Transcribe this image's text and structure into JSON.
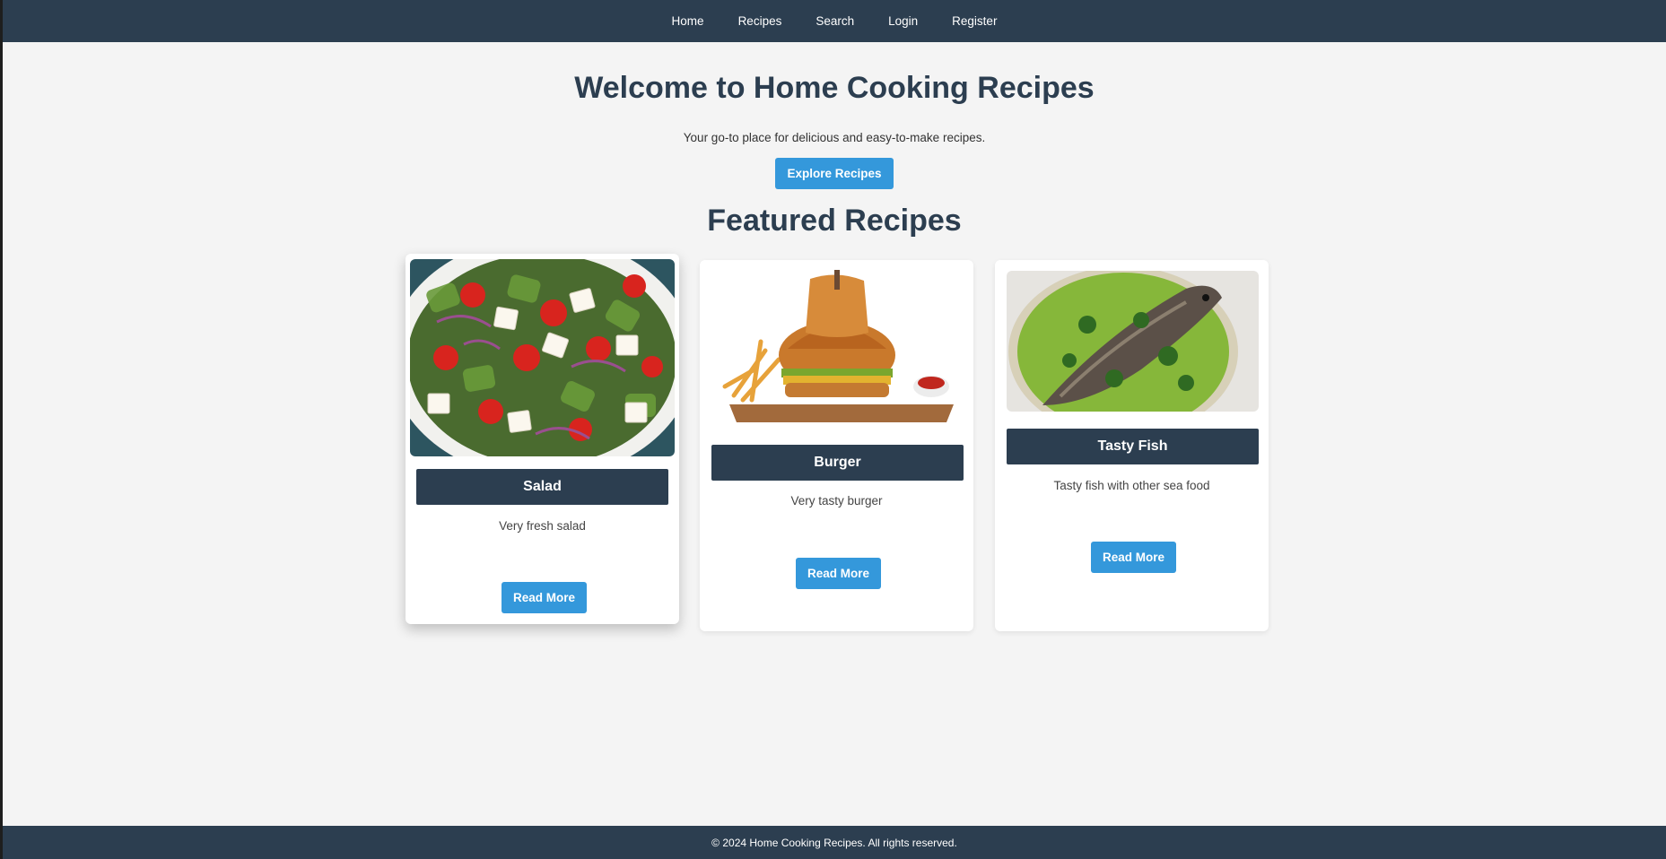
{
  "nav": {
    "items": [
      {
        "label": "Home"
      },
      {
        "label": "Recipes"
      },
      {
        "label": "Search"
      },
      {
        "label": "Login"
      },
      {
        "label": "Register"
      }
    ]
  },
  "hero": {
    "title": "Welcome to Home Cooking Recipes",
    "subtitle": "Your go-to place for delicious and easy-to-make recipes.",
    "button_label": "Explore Recipes"
  },
  "featured": {
    "title": "Featured Recipes",
    "cards": [
      {
        "title": "Salad",
        "description": "Very fresh salad",
        "button_label": "Read More",
        "image": "salad-photo"
      },
      {
        "title": "Burger",
        "description": "Very tasty burger",
        "button_label": "Read More",
        "image": "burger-photo"
      },
      {
        "title": "Tasty Fish",
        "description": "Tasty fish with other sea food",
        "button_label": "Read More",
        "image": "fish-photo"
      }
    ]
  },
  "footer": {
    "text": "© 2024 Home Cooking Recipes. All rights reserved."
  },
  "colors": {
    "nav_bg": "#2c3e50",
    "accent": "#3498db",
    "page_bg": "#f4f4f4"
  }
}
